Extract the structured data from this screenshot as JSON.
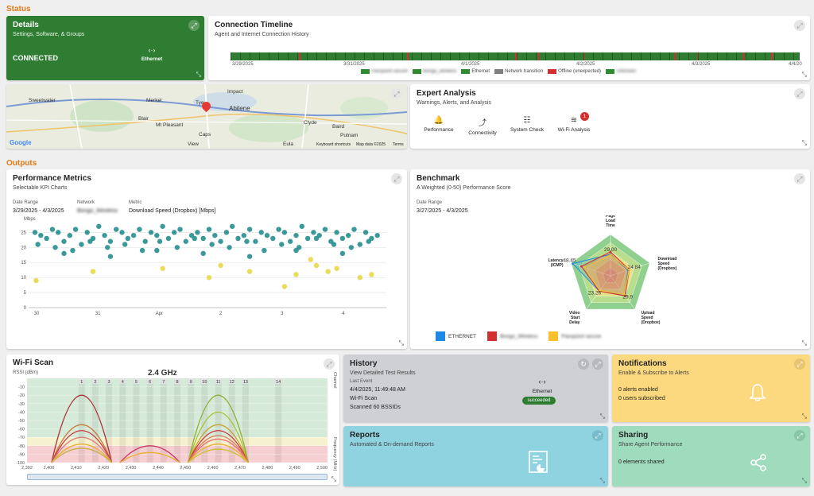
{
  "status_label": "Status",
  "outputs_label": "Outputs",
  "details": {
    "title": "Details",
    "subtitle": "Settings, Software, & Groups",
    "state": "CONNECTED",
    "conn": "Ethernet"
  },
  "timeline": {
    "title": "Connection Timeline",
    "subtitle": "Agent and Internet Connection History",
    "dates": [
      "3/29/2025",
      "3/31/2025",
      "4/1/2025",
      "4/2/2025",
      "4/3/2025",
      "4/4/20"
    ],
    "legend": [
      {
        "label": "Passpoint secure",
        "color": "#2e8b2e",
        "blur": true
      },
      {
        "label": "Bongo_wireless",
        "color": "#2e8b2e",
        "blur": true
      },
      {
        "label": "Ethernet",
        "color": "#2e8b2e",
        "blur": false
      },
      {
        "label": "Network transition",
        "color": "#808080",
        "blur": false
      },
      {
        "label": "Offline (unexpected)",
        "color": "#d32f2f",
        "blur": false
      },
      {
        "label": "Unknown",
        "color": "#2e8b2e",
        "blur": true
      }
    ]
  },
  "map": {
    "cities": [
      "Sweetwater",
      "Merkel",
      "Tye",
      "Impact",
      "Abilene",
      "Clyde",
      "Baird",
      "Blair",
      "Mt Pleasant",
      "Caps",
      "View",
      "Eula",
      "Putnam"
    ],
    "logo": "Google",
    "credit": "Keyboard shortcuts",
    "mapdata": "Map data ©2025",
    "terms": "Terms"
  },
  "expert": {
    "title": "Expert Analysis",
    "subtitle": "Warnings, Alerts, and Analysis",
    "items": [
      {
        "label": "Performance",
        "icon": "🔔"
      },
      {
        "label": "Connectivity",
        "icon": "⤴"
      },
      {
        "label": "System Check",
        "icon": "☷"
      },
      {
        "label": "Wi-Fi Analysis",
        "icon": "≋"
      }
    ],
    "badge": "1"
  },
  "perf": {
    "title": "Performance Metrics",
    "subtitle": "Selectable KPI Charts",
    "date_label": "Date Range",
    "date": "3/29/2025 - 4/3/2025",
    "net_label": "Network",
    "net": "Bongo_Wireless",
    "metric_label": "Metric",
    "metric": "Download Speed (Dropbox) [Mbps]"
  },
  "bench": {
    "title": "Benchmark",
    "subtitle": "A Weighted (0-50) Performance Score",
    "date_label": "Date Range",
    "date": "3/27/2025 - 4/3/2025",
    "legend": [
      {
        "label": "ETHERNET",
        "color": "#1e88e5",
        "blur": false
      },
      {
        "label": "Bongo_Wireless",
        "color": "#d32f2f",
        "blur": true
      },
      {
        "label": "Passpoint secure",
        "color": "#f9c02e",
        "blur": true
      }
    ]
  },
  "wifi": {
    "title": "Wi-Fi Scan",
    "band": "2.4 GHz",
    "ylabel": "RSSI (dBm)",
    "right1": "Channel",
    "right2": "Frequency (MHz)"
  },
  "history": {
    "title": "History",
    "subtitle": "View Detailed Test Results",
    "last_label": "Last Event",
    "time": "4/4/2025, 11:49:48 AM",
    "test": "Wi-Fi Scan",
    "detail": "Scanned 60 BSSIDs",
    "conn": "Ethernet",
    "status": "succeeded"
  },
  "notif": {
    "title": "Notifications",
    "subtitle": "Enable & Subscribe to Alerts",
    "l1": "0 alerts enabled",
    "l2": "0 users subscribed"
  },
  "reports": {
    "title": "Reports",
    "subtitle": "Automated & On-demand Reports"
  },
  "sharing": {
    "title": "Sharing",
    "subtitle": "Share Agent Performance",
    "l1": "0 elements shared"
  },
  "chart_data": [
    {
      "type": "scatter",
      "ylabel": "Mbps",
      "yticks": [
        0,
        5,
        10,
        15,
        20,
        25
      ],
      "ylim": [
        0,
        28
      ],
      "xticks": [
        "30",
        "31",
        "Apr",
        "2",
        "3",
        "4"
      ],
      "series": [
        {
          "name": "",
          "color": "#2a9090",
          "x": [
            0,
            0.1,
            0.2,
            0.3,
            0.4,
            0.5,
            0.6,
            0.7,
            0.8,
            0.9,
            1.0,
            1.1,
            1.2,
            1.3,
            1.4,
            1.5,
            1.6,
            1.7,
            1.8,
            1.9,
            2.0,
            2.1,
            2.2,
            2.3,
            2.4,
            2.5,
            2.6,
            2.7,
            2.8,
            2.9,
            3.0,
            3.1,
            3.2,
            3.3,
            3.4,
            3.5,
            3.6,
            3.7,
            3.8,
            3.9,
            4.0,
            4.1,
            4.2,
            4.3,
            4.4,
            4.5,
            4.6,
            4.7,
            4.8,
            4.9,
            5.0,
            5.1,
            5.2,
            5.3,
            5.4,
            5.5,
            5.6,
            5.7,
            5.8,
            5.9,
            0.05,
            0.35,
            0.65,
            0.95,
            1.25,
            1.55,
            1.85,
            2.15,
            2.45,
            2.75,
            3.05,
            3.35,
            3.65,
            3.95,
            4.25,
            4.55,
            4.85,
            5.15,
            5.45,
            5.75,
            0.5,
            1.3,
            2.1,
            2.9,
            3.7,
            4.5,
            5.3
          ],
          "y": [
            25,
            24,
            23,
            26,
            25,
            22,
            24,
            26,
            21,
            25,
            23,
            27,
            24,
            22,
            26,
            25,
            23,
            24,
            26,
            22,
            25,
            24,
            27,
            23,
            25,
            26,
            22,
            24,
            25,
            23,
            26,
            24,
            22,
            25,
            27,
            23,
            24,
            26,
            22,
            25,
            24,
            23,
            26,
            25,
            22,
            24,
            27,
            23,
            25,
            24,
            26,
            22,
            25,
            23,
            24,
            26,
            21,
            25,
            23,
            24,
            21,
            20,
            19,
            22,
            20,
            21,
            19,
            22,
            20,
            23,
            21,
            20,
            22,
            19,
            21,
            20,
            23,
            21,
            20,
            22,
            18,
            17,
            19,
            18,
            17,
            19,
            18
          ]
        },
        {
          "name": "",
          "color": "#e8d84a",
          "x": [
            0.02,
            1.0,
            2.2,
            3.0,
            3.2,
            3.7,
            4.3,
            4.5,
            4.75,
            4.85,
            5.05,
            5.2,
            5.6,
            5.8
          ],
          "y": [
            9,
            12,
            13,
            10,
            14,
            12,
            7,
            11,
            16,
            14,
            12,
            13,
            10,
            11
          ]
        }
      ]
    },
    {
      "type": "radar",
      "axes": [
        "Page Load Time",
        "Download Speed (Dropbox)",
        "Upload Speed (Dropbox)",
        "Video Start Delay",
        "Latency (ICMP)"
      ],
      "max": 50,
      "series": [
        {
          "name": "ETHERNET",
          "color": "#1e88e5",
          "values": [
            26,
            22,
            29,
            23,
            48
          ]
        },
        {
          "name": "Bongo_Wireless",
          "color": "#d32f2f",
          "values": [
            29,
            24,
            30,
            23,
            37
          ]
        },
        {
          "name": "Passpoint secure",
          "color": "#f9c02e",
          "values": [
            25,
            24,
            28,
            22,
            33
          ]
        }
      ],
      "labels": [
        "29.00",
        "24.84",
        "29.9",
        "23.26",
        "48.45"
      ]
    },
    {
      "type": "area",
      "title": "2.4 GHz",
      "ylabel": "RSSI (dBm)",
      "yticks": [
        -10,
        -20,
        -30,
        -40,
        -50,
        -60,
        -70,
        -80,
        -90,
        -100
      ],
      "ylim": [
        -100,
        0
      ],
      "xticks": [
        "2,392",
        "2,400",
        "2,410",
        "2,420",
        "2,430",
        "2,440",
        "2,450",
        "2,460",
        "2,470",
        "2,480",
        "2,490",
        "2,500"
      ],
      "xlim": [
        2392,
        2502
      ],
      "channels": [
        "1",
        "2",
        "3",
        "4",
        "5",
        "6",
        "7",
        "8",
        "9",
        "10",
        "11",
        "12",
        "13",
        "14"
      ],
      "series": [
        {
          "channel": 1,
          "peak": -20,
          "color": "#a83232"
        },
        {
          "channel": 1,
          "peak": -55,
          "color": "#c87a3a"
        },
        {
          "channel": 1,
          "peak": -62,
          "color": "#c83a3a"
        },
        {
          "channel": 1,
          "peak": -70,
          "color": "#d88080"
        },
        {
          "channel": 1,
          "peak": -78,
          "color": "#e8b030"
        },
        {
          "channel": 1,
          "peak": -83,
          "color": "#c8b040"
        },
        {
          "channel": 6,
          "peak": -80,
          "color": "#c83a6a"
        },
        {
          "channel": 6,
          "peak": -88,
          "color": "#e8b030"
        },
        {
          "channel": 11,
          "peak": -20,
          "color": "#88b030"
        },
        {
          "channel": 11,
          "peak": -40,
          "color": "#a8c030"
        },
        {
          "channel": 11,
          "peak": -55,
          "color": "#c8a030"
        },
        {
          "channel": 11,
          "peak": -62,
          "color": "#c83a3a"
        },
        {
          "channel": 11,
          "peak": -68,
          "color": "#d88060"
        },
        {
          "channel": 11,
          "peak": -72,
          "color": "#e87070"
        },
        {
          "channel": 11,
          "peak": -78,
          "color": "#e8b030"
        },
        {
          "channel": 11,
          "peak": -84,
          "color": "#c8c030"
        }
      ]
    }
  ]
}
